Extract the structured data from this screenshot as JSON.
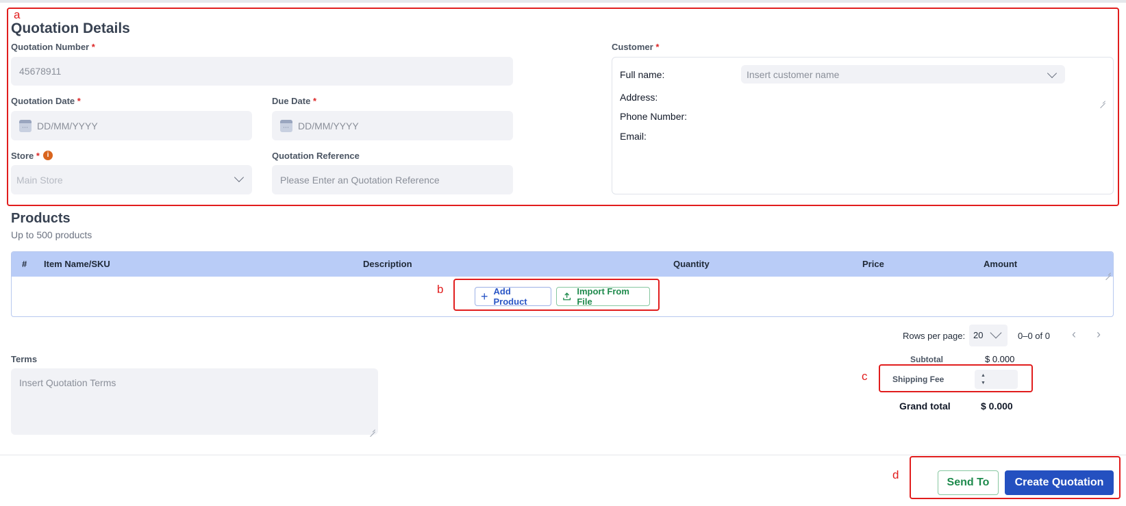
{
  "annotations": {
    "a": "a",
    "b": "b",
    "c": "c",
    "d": "d"
  },
  "details": {
    "title": "Quotation Details",
    "quotation_number_label": "Quotation Number",
    "quotation_number_value": "45678911",
    "quotation_date_label": "Quotation Date",
    "quotation_date_placeholder": "DD/MM/YYYY",
    "due_date_label": "Due Date",
    "due_date_placeholder": "DD/MM/YYYY",
    "store_label": "Store",
    "store_value": "Main Store",
    "reference_label": "Quotation Reference",
    "reference_placeholder": "Please Enter an Quotation Reference",
    "required_mark": "*",
    "info_glyph": "i"
  },
  "customer": {
    "label": "Customer",
    "full_name_label": "Full name:",
    "full_name_placeholder": "Insert customer name",
    "address_label": "Address:",
    "phone_label": "Phone Number:",
    "email_label": "Email:"
  },
  "products": {
    "title": "Products",
    "subtitle": "Up to 500 products",
    "columns": [
      "#",
      "Item Name/SKU",
      "Description",
      "Quantity",
      "Price",
      "Amount"
    ],
    "add_product_label": "Add Product",
    "import_label": "Import From File"
  },
  "pagination": {
    "rows_per_page_label": "Rows per page:",
    "rows_per_page_value": "20",
    "range": "0–0 of 0",
    "prev_glyph": "‹",
    "next_glyph": "›"
  },
  "terms": {
    "label": "Terms",
    "placeholder": "Insert Quotation Terms"
  },
  "summary": {
    "subtotal_label": "Subtotal",
    "subtotal_value": "$ 0.000",
    "shipping_label": "Shipping Fee",
    "grand_label": "Grand total",
    "grand_value": "$ 0.000"
  },
  "actions": {
    "send_label": "Send To",
    "create_label": "Create Quotation"
  },
  "colors": {
    "primary": "#2450c0",
    "success": "#1e8a4c",
    "annotation": "#e11d1d",
    "table_header": "#b9ccf7"
  }
}
